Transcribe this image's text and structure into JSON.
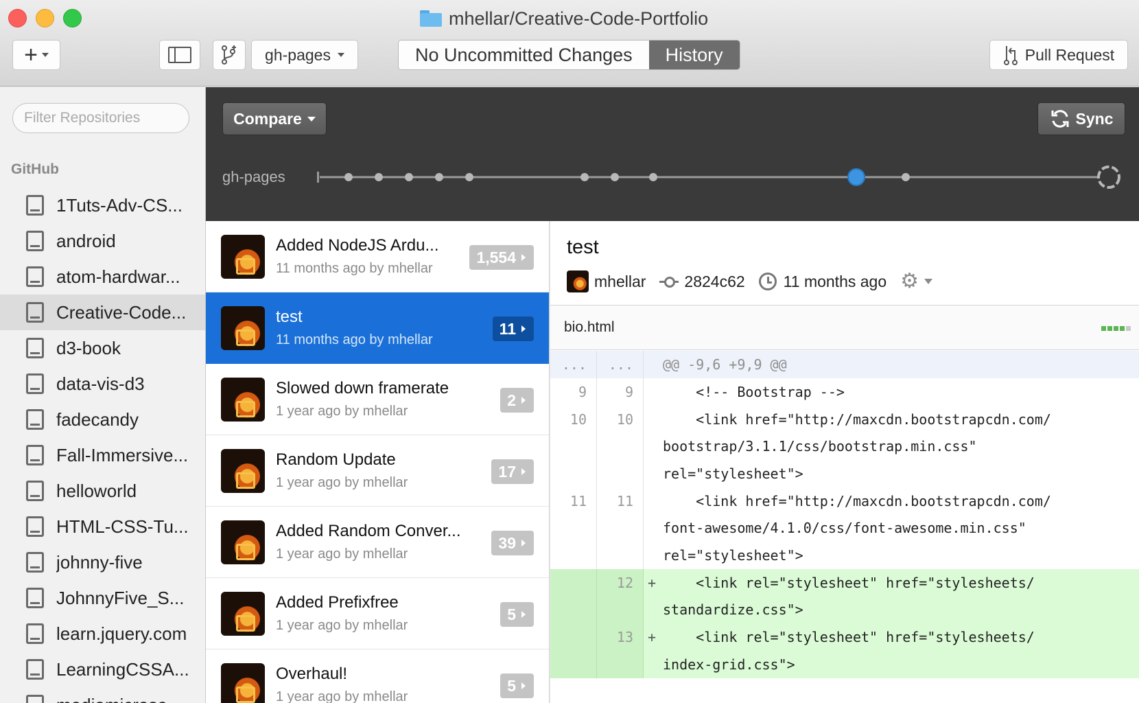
{
  "window": {
    "title": "mhellar/Creative-Code-Portfolio"
  },
  "toolbar": {
    "add_label": "+",
    "branch": "gh-pages",
    "segments": [
      "No Uncommitted Changes",
      "History"
    ],
    "pull_request": "Pull Request"
  },
  "sidebar": {
    "filter_placeholder": "Filter Repositories",
    "section": "GitHub",
    "repos": [
      "1Tuts-Adv-CS...",
      "android",
      "atom-hardwar...",
      "Creative-Code...",
      "d3-book",
      "data-vis-d3",
      "fadecandy",
      "Fall-Immersive...",
      "helloworld",
      "HTML-CSS-Tu...",
      "johnny-five",
      "JohnnyFive_S...",
      "learn.jquery.com",
      "LearningCSSA...",
      "mediamicrose..."
    ]
  },
  "timeline": {
    "compare": "Compare",
    "sync": "Sync",
    "branch": "gh-pages"
  },
  "commits": [
    {
      "title": "Added NodeJS Ardu...",
      "meta": "11 months ago by mhellar",
      "count": "1,554"
    },
    {
      "title": "test",
      "meta": "11 months ago by mhellar",
      "count": "11"
    },
    {
      "title": "Slowed down framerate",
      "meta": "1 year ago by mhellar",
      "count": "2"
    },
    {
      "title": "Random Update",
      "meta": "1 year ago by mhellar",
      "count": "17"
    },
    {
      "title": "Added Random Conver...",
      "meta": "1 year ago by mhellar",
      "count": "39"
    },
    {
      "title": "Added Prefixfree",
      "meta": "1 year ago by mhellar",
      "count": "5"
    },
    {
      "title": "Overhaul!",
      "meta": "1 year ago by mhellar",
      "count": "5"
    }
  ],
  "detail": {
    "title": "test",
    "author": "mhellar",
    "sha": "2824c62",
    "time": "11 months ago",
    "file": "bio.html",
    "hunk": "@@ -9,6 +9,9 @@",
    "hunk_ln": "...",
    "lines": [
      {
        "old": "9",
        "new": "9",
        "sign": "",
        "text": "    <!-- Bootstrap -->",
        "type": "ctx"
      },
      {
        "old": "10",
        "new": "10",
        "sign": "",
        "text": "    <link href=\"http://maxcdn.bootstrapcdn.com/",
        "type": "ctx"
      },
      {
        "old": "",
        "new": "",
        "sign": "",
        "text": "bootstrap/3.1.1/css/bootstrap.min.css\"",
        "type": "ctx"
      },
      {
        "old": "",
        "new": "",
        "sign": "",
        "text": "rel=\"stylesheet\">",
        "type": "ctx"
      },
      {
        "old": "11",
        "new": "11",
        "sign": "",
        "text": "    <link href=\"http://maxcdn.bootstrapcdn.com/",
        "type": "ctx"
      },
      {
        "old": "",
        "new": "",
        "sign": "",
        "text": "font-awesome/4.1.0/css/font-awesome.min.css\"",
        "type": "ctx"
      },
      {
        "old": "",
        "new": "",
        "sign": "",
        "text": "rel=\"stylesheet\">",
        "type": "ctx"
      },
      {
        "old": "",
        "new": "12",
        "sign": "+",
        "text": "    <link rel=\"stylesheet\" href=\"stylesheets/",
        "type": "add"
      },
      {
        "old": "",
        "new": "",
        "sign": "",
        "text": "standardize.css\">",
        "type": "add"
      },
      {
        "old": "",
        "new": "13",
        "sign": "+",
        "text": "    <link rel=\"stylesheet\" href=\"stylesheets/",
        "type": "add"
      },
      {
        "old": "",
        "new": "",
        "sign": "",
        "text": "index-grid.css\">",
        "type": "add"
      }
    ]
  },
  "colors": {
    "selected_blue": "#1a70d8",
    "timeline_bg": "#3a3a3a",
    "added_line_bg": "#dbfbd6"
  }
}
